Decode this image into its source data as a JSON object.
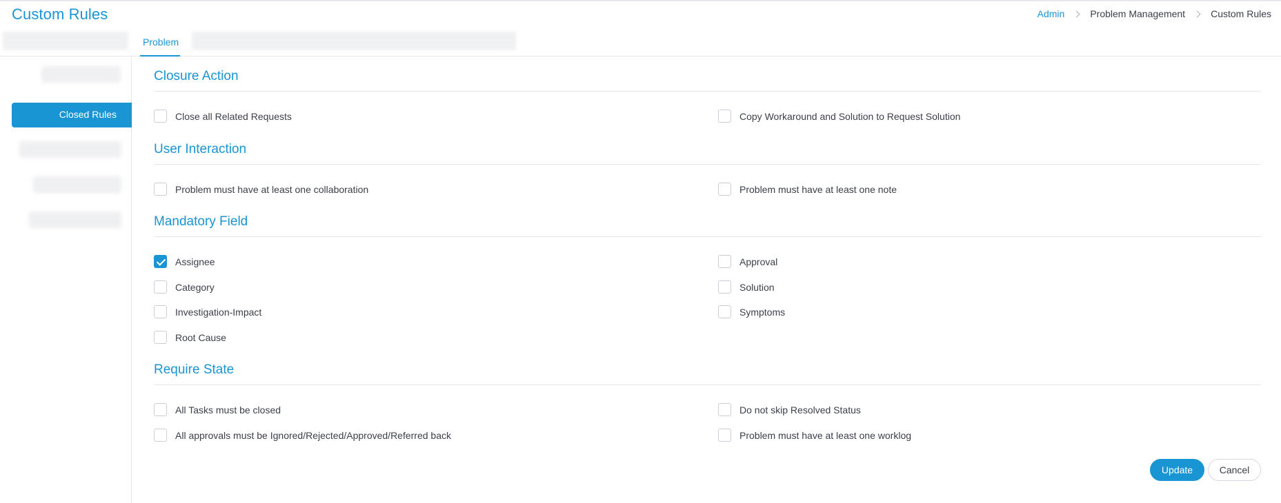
{
  "header": {
    "title": "Custom Rules",
    "breadcrumb": [
      "Admin",
      "Problem Management",
      "Custom Rules"
    ]
  },
  "tabs": {
    "active_label": "Problem"
  },
  "sidebar": {
    "active_label": "Closed Rules"
  },
  "sections": {
    "closure_action": {
      "title": "Closure Action",
      "options": [
        {
          "label": "Close all Related Requests",
          "checked": false
        },
        {
          "label": "Copy Workaround and Solution to Request Solution",
          "checked": false
        }
      ]
    },
    "user_interaction": {
      "title": "User Interaction",
      "options": [
        {
          "label": "Problem must have at least one collaboration",
          "checked": false
        },
        {
          "label": "Problem must have at least one note",
          "checked": false
        }
      ]
    },
    "mandatory_field": {
      "title": "Mandatory Field",
      "options": [
        {
          "label": "Assignee",
          "checked": true
        },
        {
          "label": "Approval",
          "checked": false
        },
        {
          "label": "Category",
          "checked": false
        },
        {
          "label": "Solution",
          "checked": false
        },
        {
          "label": "Investigation-Impact",
          "checked": false
        },
        {
          "label": "Symptoms",
          "checked": false
        },
        {
          "label": "Root Cause",
          "checked": false
        }
      ]
    },
    "require_state": {
      "title": "Require State",
      "options": [
        {
          "label": "All Tasks must be closed",
          "checked": false
        },
        {
          "label": "Do not skip Resolved Status",
          "checked": false
        },
        {
          "label": "All approvals must be Ignored/Rejected/Approved/Referred back",
          "checked": false
        },
        {
          "label": "Problem must have at least one worklog",
          "checked": false
        }
      ]
    }
  },
  "actions": {
    "update_label": "Update",
    "cancel_label": "Cancel"
  },
  "colors": {
    "accent": "#1a95d3",
    "text": "#3a3f4a",
    "border": "#e3e6ea"
  }
}
